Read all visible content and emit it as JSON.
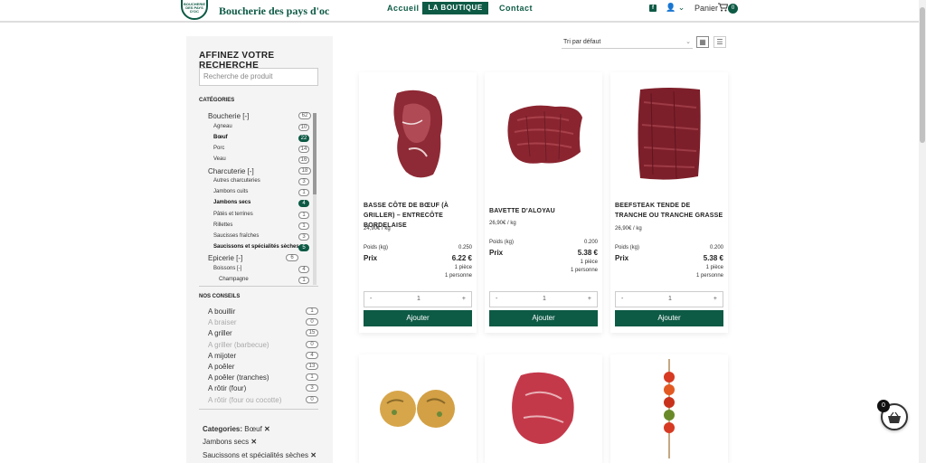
{
  "header": {
    "logo_lines": [
      "BOUCHERIE",
      "DES PAYS",
      "D'OC"
    ],
    "brand": "Boucherie des pays d'oc",
    "nav": [
      "Accueil",
      "LA BOUTIQUE",
      "Contact"
    ],
    "cart_label": "Panier",
    "cart_count": "0",
    "fb": "f",
    "user": "👤 ⌄"
  },
  "sidebar": {
    "title": "AFFINEZ VOTRE RECHERCHE",
    "search_placeholder": "Recherche de produit",
    "categories_title": "CATÉGORIES",
    "categories": [
      {
        "label": "Boucherie [-]",
        "count": "62"
      },
      {
        "label": "Agneau",
        "count": "10"
      },
      {
        "label": "Bœuf",
        "count": "22"
      },
      {
        "label": "Porc",
        "count": "14"
      },
      {
        "label": "Veau",
        "count": "16"
      },
      {
        "label": "Charcuterie [-]",
        "count": "18"
      },
      {
        "label": "Autres charcuteries",
        "count": "3"
      },
      {
        "label": "Jambons cuits",
        "count": "1"
      },
      {
        "label": "Jambons secs",
        "count": "4"
      },
      {
        "label": "Pâtés et terrines",
        "count": "1"
      },
      {
        "label": "Rillettes",
        "count": "1"
      },
      {
        "label": "Saucisses fraîches",
        "count": "3"
      },
      {
        "label": "Saucissons et spécialités sèches",
        "count": "5"
      },
      {
        "label": "Epicerie [-]",
        "count": "6"
      },
      {
        "label": "Boissons [-]",
        "count": "4"
      },
      {
        "label": "Champagne",
        "count": "1"
      }
    ],
    "conseils_title": "NOS CONSEILS",
    "conseils": [
      {
        "label": "A bouillir",
        "count": "1"
      },
      {
        "label": "A braiser",
        "count": "0"
      },
      {
        "label": "A griller",
        "count": "15"
      },
      {
        "label": "A griller (barbecue)",
        "count": "0"
      },
      {
        "label": "A mijoter",
        "count": "4"
      },
      {
        "label": "A poêler",
        "count": "13"
      },
      {
        "label": "A poêler (tranches)",
        "count": "1"
      },
      {
        "label": "A rôtir (four)",
        "count": "3"
      },
      {
        "label": "A rôtir (four ou cocotte)",
        "count": "0"
      }
    ],
    "filters_prefix": "Categories:",
    "filters": [
      "Bœuf",
      "Jambons secs",
      "Saucissons et spécialités sèches"
    ],
    "remove": "✕"
  },
  "toolbar": {
    "sort": "Tri par défaut",
    "grid_icon": "▦",
    "list_icon": "☰"
  },
  "products": [
    {
      "title": "BASSE CÔTE DE BŒUF (À GRILLER) – ENTRECÔTE BORDELAISE",
      "price_per_kg": "24,90€ / kg",
      "poids_label": "Poids (kg)",
      "poids": "0.250",
      "prix_label": "Prix",
      "prix": "6.22 €",
      "piece": "1 pièce",
      "personne": "1 personne",
      "qty": "1",
      "add": "Ajouter"
    },
    {
      "title": "BAVETTE D'ALOYAU",
      "price_per_kg": "26,90€ / kg",
      "poids_label": "Poids (kg)",
      "poids": "0.200",
      "prix_label": "Prix",
      "prix": "5.38 €",
      "piece": "1 pièce",
      "personne": "1 personne",
      "qty": "1",
      "add": "Ajouter"
    },
    {
      "title": "BEEFSTEAK TENDE DE TRANCHE OU TRANCHE GRASSE",
      "price_per_kg": "26,90€ / kg",
      "poids_label": "Poids (kg)",
      "poids": "0.200",
      "prix_label": "Prix",
      "prix": "5.38 €",
      "piece": "1 pièce",
      "personne": "1 personne",
      "qty": "1",
      "add": "Ajouter"
    }
  ],
  "qty_minus": "-",
  "qty_plus": "+",
  "float_cart_count": "0",
  "colors": {
    "brand": "#0d5a45"
  }
}
